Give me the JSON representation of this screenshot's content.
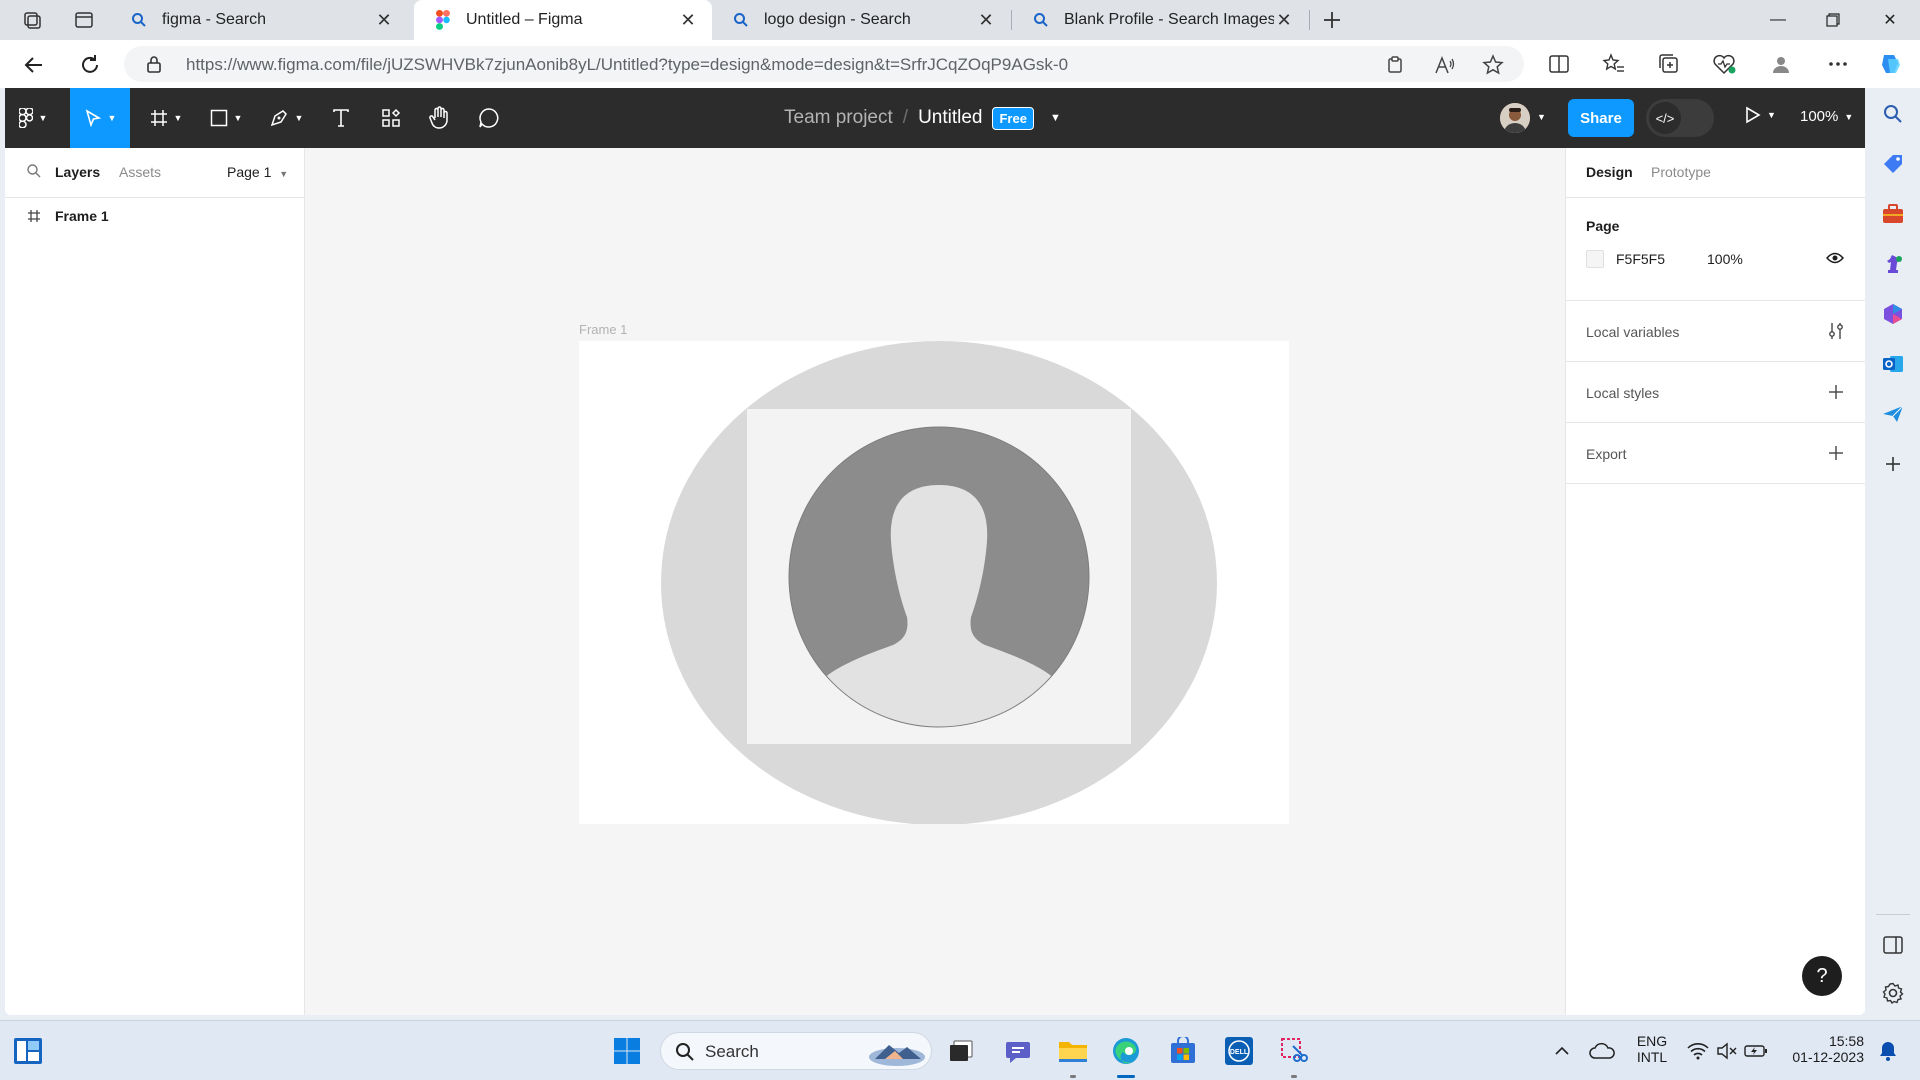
{
  "browser": {
    "tabs": [
      {
        "title": "figma - Search",
        "icon": "search-icon"
      },
      {
        "title": "Untitled – Figma",
        "icon": "figma-icon",
        "active": true
      },
      {
        "title": "logo design - Search",
        "icon": "search-icon"
      },
      {
        "title": "Blank Profile - Search Images",
        "icon": "search-icon"
      }
    ],
    "url": "https://www.figma.com/file/jUZSWHVBk7zjunAonib8yL/Untitled?type=design&mode=design&t=SrfrJCqZOqP9AGsk-0"
  },
  "figma": {
    "breadcrumb_team": "Team project",
    "file_name": "Untitled",
    "plan_badge": "Free",
    "share_label": "Share",
    "zoom": "100%",
    "left_panel": {
      "tab_layers": "Layers",
      "tab_assets": "Assets",
      "page_selector": "Page 1",
      "layers": [
        "Frame 1"
      ]
    },
    "canvas": {
      "frame_label": "Frame 1"
    },
    "right_panel": {
      "tab_design": "Design",
      "tab_prototype": "Prototype",
      "page_heading": "Page",
      "page_color": "F5F5F5",
      "page_opacity": "100%",
      "sections": [
        "Local variables",
        "Local styles",
        "Export"
      ]
    },
    "help_label": "?"
  },
  "taskbar": {
    "search_label": "Search",
    "lang_line1": "ENG",
    "lang_line2": "INTL",
    "time": "15:58",
    "date": "01-12-2023"
  },
  "colors": {
    "figma_blue": "#0d99ff",
    "figma_toolbar": "#2c2c2c",
    "canvas_bg": "#F5F5F5"
  }
}
